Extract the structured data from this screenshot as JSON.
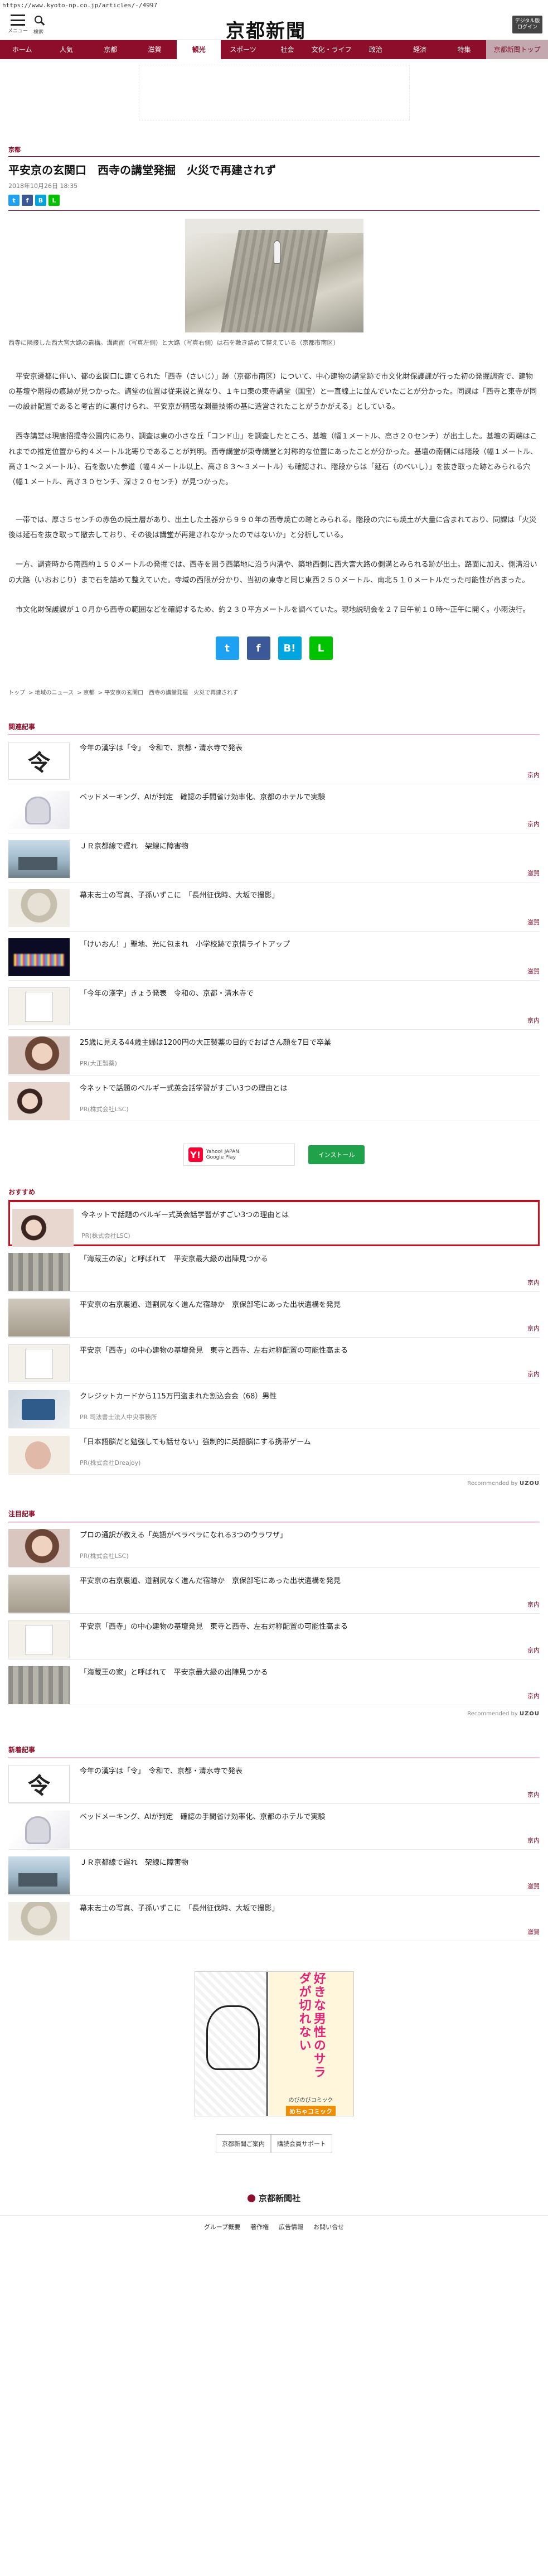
{
  "url": "https://www.kyoto-np.co.jp/articles/-/4997",
  "header": {
    "menu_label": "メニュー",
    "search_label": "検索",
    "logo": "京都新聞",
    "digital_badge": "デジタル版ログイン"
  },
  "nav": [
    "ホーム",
    "人気",
    "京都",
    "滋賀",
    "観光",
    "スポーツ",
    "社会",
    "文化・ライフ",
    "政治",
    "経済",
    "特集",
    "京都新聞トップ"
  ],
  "article": {
    "category": "京都",
    "title": "平安京の玄関口　西寺の講堂発掘　火災で再建されず",
    "date": "2018年10月26日 18:35",
    "caption": "西寺に隣接した西大宮大路の遺構。溝両面（写真左側）と大路（写真右側）は石を敷き詰めて整えている（京都市南区）",
    "paragraphs": [
      "平安京遷都に伴い、都の玄関口に建てられた「西寺（さいじ）」跡（京都市南区）について、中心建物の講堂跡で市文化財保護課が行った初の発掘調査で、建物の基壇や階段の痕跡が見つかった。講堂の位置は従来説と異なり、１キロ東の東寺講堂（国宝）と一直線上に並んでいたことが分かった。同課は「西寺と東寺が同一の設計配置であると考古的に裏付けられ、平安京が精密な測量技術の基に造営されたことがうかがえる」としている。",
      "西寺講堂は現唐招提寺公園内にあり、調査は東の小さな丘「コンド山」を調査したところ、基壇（幅１メートル、高さ２０センチ）が出土した。基壇の両端はこれまでの推定位置から約４メートル北寄りであることが判明。西寺講堂が東寺講堂と対称的な位置にあったことが分かった。基壇の南側には階段（幅１メートル、高さ１～２メートル）、石を敷いた参道（幅４メートル以上、高さ８３～３メートル）も確認され、階段からは「延石（のべいし）」を抜き取った跡とみられる穴（幅１メートル、高さ３０センチ、深さ２０センチ）が見つかった。",
      "一帯では、厚さ５センチの赤色の焼土層があり、出土した土器から９９０年の西寺焼亡の跡とみられる。階段の穴にも焼土が大量に含まれており、同課は「火災後は延石を抜き取って撤去しており、その後は講堂が再建されなかったのではないか」と分析している。",
      "一方、調査時から南西約１５０メートルの発掘では、西寺を囲う西築地に沿う内溝や、築地西側に西大宮大路の側溝とみられる跡が出土。路面に加え、側溝沿いの大路（いおおじり）まで石を詰めて整えていた。寺域の西限が分かり、当初の東寺と同じ東西２５０メートル、南北５１０メートルだった可能性が高まった。",
      "市文化財保護課が１０月から西寺の範囲などを確認するため、約２３０平方メートルを調べていた。現地説明会を２７日午前１０時～正午に開く。小雨決行。"
    ]
  },
  "breadcrumb": [
    "トップ",
    "地域のニュース",
    "京都",
    "平安京の玄関口　西寺の講堂発掘　火災で再建されず"
  ],
  "related_heading": "関連記事",
  "related": [
    {
      "title": "今年の漢字は「令」　令和で、京都・清水寺で発表",
      "tag": "京内"
    },
    {
      "title": "ベッドメーキング、AIが判定　確認の手間省け効率化、京都のホテルで実験",
      "tag": "京内"
    },
    {
      "title": "ＪＲ京都線で遅れ　架線に障害物",
      "tag": "滋賀"
    },
    {
      "title": "幕末志士の写真、子孫いずこに　「長州征伐時、大坂で撮影」",
      "tag": "滋賀"
    },
    {
      "title": "「けいおん！」聖地、光に包まれ　小学校跡で京情ライトアップ",
      "tag": "滋賀"
    },
    {
      "title": "「今年の漢字」きょう発表　令和の、京都・清水寺で",
      "tag": "京内"
    },
    {
      "title": "25歳に見える44歳主婦は1200円の大正製薬の目的でおばさん顔を7日で卒業",
      "sponsor": "PR(大正製薬)"
    },
    {
      "title": "今ネットで話題のベルギー式英会話学習がすごい3つの理由とは",
      "sponsor": "PR(株式会社LSC)"
    }
  ],
  "app_banner": {
    "store": "Yahoo! JAPAN",
    "sub": "Google Play",
    "install": "インストール"
  },
  "recommend_heading": "おすすめ",
  "recommend": [
    {
      "title": "今ネットで話題のベルギー式英会話学習がすごい3つの理由とは",
      "sponsor": "PR(株式会社LSC)"
    },
    {
      "title": "「海蔵王の家」と呼ばれて　平安京最大級の出陣見つかる",
      "tag": "京内"
    },
    {
      "title": "平安京の右京裏道、道割尻なく進んだ宿跡か　京保部宅にあった出状遺構を発見",
      "tag": "京内"
    },
    {
      "title": "平安京「西寺」の中心建物の基壇発見　東寺と西寺、左右対称配置の可能性高まる",
      "tag": "京内"
    },
    {
      "title": "クレジットカードから115万円盗まれた割込会会（68）男性",
      "sponsor": "PR 司法書士法人中央事務所"
    },
    {
      "title": "「日本語脳だと勉強しても話せない」強制的に英語脳にする携帯ゲーム",
      "sponsor": "PR(株式会社Dreajoy)"
    }
  ],
  "powered_by": "Recommended by",
  "powered_brand": "UZOU",
  "attention_heading": "注目記事",
  "attention": [
    {
      "title": "プロの通訳が教える「英語がペラペラになれる3つのウラワザ」",
      "sponsor": "PR(株式会社LSC)"
    },
    {
      "title": "平安京の右京裏道、道割尻なく進んだ宿跡か　京保部宅にあった出状遺構を発見",
      "tag": "京内"
    },
    {
      "title": "平安京「西寺」の中心建物の基壇発見　東寺と西寺、左右対称配置の可能性高まる",
      "tag": "京内"
    },
    {
      "title": "「海蔵王の家」と呼ばれて　平安京最大級の出陣見つかる",
      "tag": "京内"
    }
  ],
  "new_heading": "新着記事",
  "new_articles": [
    {
      "title": "今年の漢字は「令」　令和で、京都・清水寺で発表",
      "tag": "京内"
    },
    {
      "title": "ベッドメーキング、AIが判定　確認の手間省け効率化、京都のホテルで実験",
      "tag": "京内"
    },
    {
      "title": "ＪＲ京都線で遅れ　架線に障害物",
      "tag": "滋賀"
    },
    {
      "title": "幕末志士の写真、子孫いずこに　「長州征伐時、大坂で撮影」",
      "tag": "滋賀"
    }
  ],
  "manga": {
    "title": "好きな男性のサラダが切れない",
    "sub": "のびのびコミック",
    "brand": "めちゃコミック"
  },
  "footer_links": [
    "京都新聞ご案内",
    "購読会員サポート"
  ],
  "footer_logo": "京都新聞社",
  "footer_bottom": [
    "グループ概要",
    "著作権",
    "広告情報",
    "お問い合せ"
  ]
}
